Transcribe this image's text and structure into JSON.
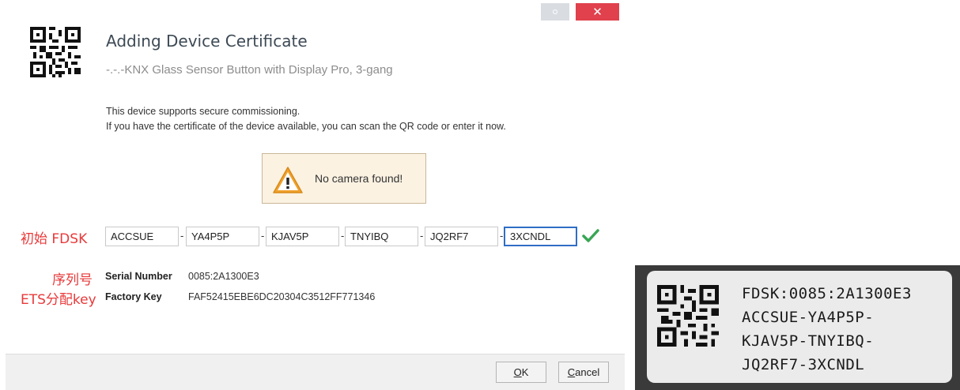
{
  "window": {
    "close_glyph": "✕",
    "title": "Adding Device Certificate",
    "subtitle": "-.-.-KNX Glass Sensor Button with Display Pro, 3-gang"
  },
  "info": {
    "line1": "This device supports secure commissioning.",
    "line2": "If you have the certificate of the device available, you can scan the QR code or enter it now."
  },
  "warning": {
    "message": "No camera found!",
    "icon": "warning-triangle-icon"
  },
  "fdsk": {
    "annotation": "初始 FDSK",
    "fields": [
      "ACCSUE",
      "YA4P5P",
      "KJAV5P",
      "TNYIBQ",
      "JQ2RF7",
      "3XCNDL"
    ],
    "separator": "-",
    "valid_icon": "checkmark-icon"
  },
  "serial": {
    "annotation": "序列号",
    "label": "Serial Number",
    "value": "0085:2A1300E3"
  },
  "factory": {
    "annotation": "ETS分配key",
    "label": "Factory Key",
    "value": "FAF52415EBE6DC20304C3512FF771346"
  },
  "footer": {
    "ok_accel": "O",
    "ok_rest": "K",
    "cancel_accel": "C",
    "cancel_rest": "ancel"
  },
  "device_label": {
    "line1": "FDSK:0085:2A1300E3",
    "line2": "ACCSUE-YA4P5P-",
    "line3": "KJAV5P-TNYIBQ-",
    "line4": "JQ2RF7-3XCNDL"
  },
  "colors": {
    "accent": "#2f6ec5",
    "close": "#e0414d",
    "annotation": "#e8393a",
    "success": "#3aa655",
    "warning_bg": "#fbf2e2"
  }
}
